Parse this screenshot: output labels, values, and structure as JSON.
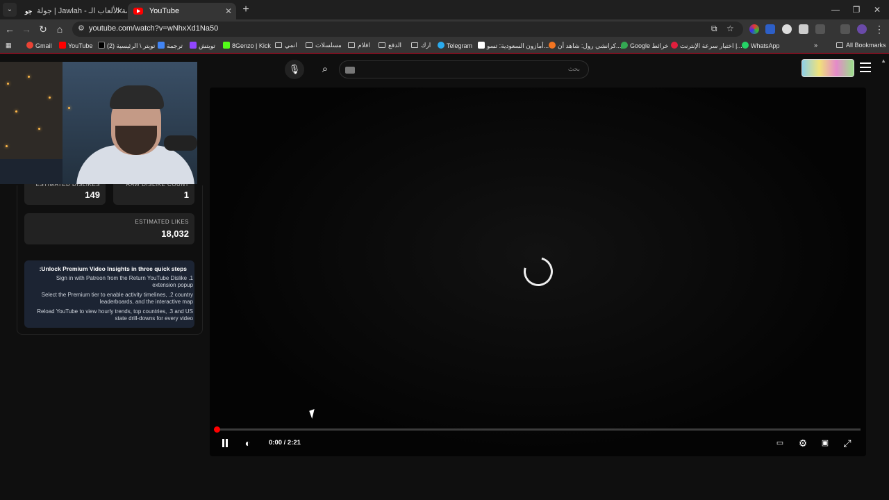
{
  "browser": {
    "tabs": [
      {
        "title": "جولة | Jawlah - منصة الألعاب الـ..."
      },
      {
        "title": "YouTube"
      }
    ],
    "url": "youtube.com/watch?v=wNhxXd1Na50",
    "bookmarks": [
      {
        "label": "Gmail",
        "color": "#ea4335"
      },
      {
        "label": "YouTube",
        "color": "#ff0000"
      },
      {
        "label": "(2) تويتر \\ الرئيسية",
        "color": "#000000"
      },
      {
        "label": "ترجمة",
        "color": "#4285f4"
      },
      {
        "label": "تويتش",
        "color": "#9146ff"
      },
      {
        "label": "8Genzo | Kick",
        "color": "#53fc18"
      },
      {
        "label": "انمي",
        "folder": true
      },
      {
        "label": "مسلسلات",
        "folder": true
      },
      {
        "label": "افلام",
        "folder": true
      },
      {
        "label": "الدفع",
        "folder": true
      },
      {
        "label": "ارك",
        "folder": true
      },
      {
        "label": "Telegram",
        "color": "#2aabee"
      },
      {
        "label": "أمازون السعودية: تسو...",
        "color": "#ffffff"
      },
      {
        "label": "كرانشي رول: شاهد أن...",
        "color": "#f47521"
      },
      {
        "label": "Google خرائط",
        "color": "#34a853"
      },
      {
        "label": "اختبار سرعة الإنترنت |...",
        "color": "#e01f3d"
      },
      {
        "label": "WhatsApp",
        "color": "#25d366"
      }
    ],
    "all_bookmarks": "All Bookmarks",
    "more_bookmarks": "»"
  },
  "header": {
    "search_placeholder": "بحث"
  },
  "stats": {
    "dislikes_label": "ESTIMATED DISLIKES",
    "dislikes_value": "149",
    "raw_dislike_label": "RAW DISLIKE COUNT",
    "raw_dislike_value": "1",
    "likes_label": "ESTIMATED LIKES",
    "likes_value": "18,032"
  },
  "premium": {
    "title": ":Unlock Premium Video Insights in three quick steps",
    "steps": [
      "Sign in with Patreon from the Return YouTube Dislike .1 extension popup",
      "Select the Premium tier to enable activity timelines, .2 country leaderboards, and the interactive map",
      "Reload YouTube to view hourly trends, top countries, .3 and US state drill-downs for every video"
    ]
  },
  "player": {
    "time": "0:00 / 2:21",
    "progress": 0.004,
    "state": "loading"
  }
}
